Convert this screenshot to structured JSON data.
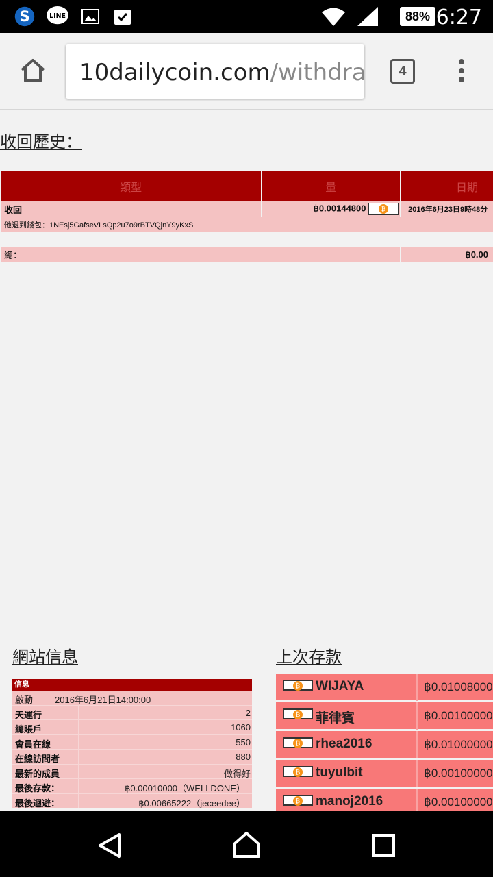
{
  "status": {
    "battery": "88%",
    "time": "6:27"
  },
  "browser": {
    "host": "10dailycoin.com",
    "path": "/withdraw",
    "tab_count": "4"
  },
  "history": {
    "title": "收回歷史：",
    "headers": [
      "類型",
      "量",
      "日期"
    ],
    "row": {
      "type": "收回",
      "amount": "฿0.00144800",
      "date": "2016年6月23日9時48分"
    },
    "wallet_note": "他退到錢包：1NEsj5GafseVLsQp2u7o9rBTVQjnY9yKxS",
    "total_label": "總：",
    "total_value": "฿0.00"
  },
  "site_info": {
    "title": "網站信息",
    "head": "信息",
    "launch_label": "啟動",
    "launch_value": "2016年6月21日14:00:00",
    "rows": [
      {
        "label": "天運行",
        "value": "2"
      },
      {
        "label": "總賬戶",
        "value": "1060"
      },
      {
        "label": "會員在線",
        "value": "550"
      },
      {
        "label": "在線訪問者",
        "value": "880"
      },
      {
        "label": "最新的成員",
        "value": "做得好"
      },
      {
        "label": "最後存款：",
        "value": "฿0.00010000（WELLDONE）"
      },
      {
        "label": "最後迴避：",
        "value": "฿0.00665222（jeceedee）"
      }
    ]
  },
  "deposits": {
    "title": "上次存款",
    "items": [
      {
        "name": "WIJAYA",
        "amount": "฿0.01008000"
      },
      {
        "name": "菲律賓",
        "amount": "฿0.00100000"
      },
      {
        "name": "rhea2016",
        "amount": "฿0.01000000"
      },
      {
        "name": "tuyulbit",
        "amount": "฿0.00100000"
      },
      {
        "name": "manoj2016",
        "amount": "฿0.00100000"
      }
    ]
  },
  "colors": {
    "accent": "#a40000",
    "row_bg": "#f4c2c2",
    "deposit_bg": "#f87878"
  }
}
